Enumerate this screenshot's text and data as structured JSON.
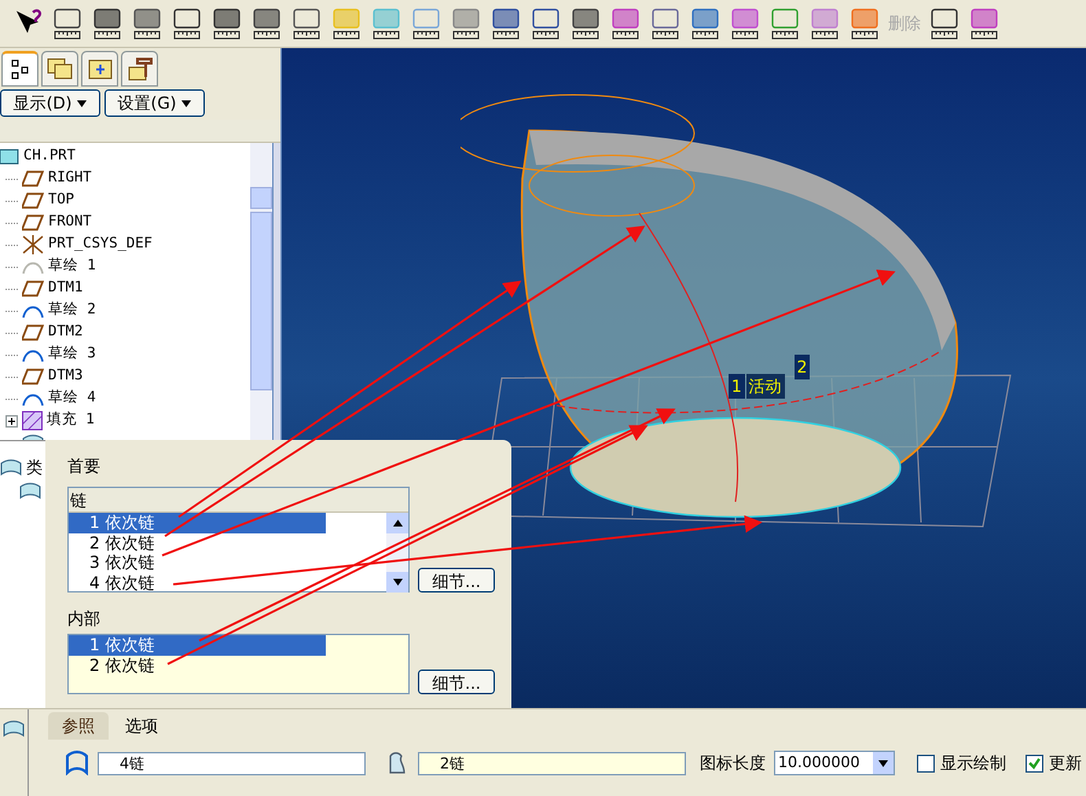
{
  "toolbar": {
    "delete_label": "删除",
    "delete_disabled": true
  },
  "model_tree": {
    "tabs": [
      {
        "kind": "tree",
        "selected": true
      },
      {
        "kind": "layers",
        "selected": false
      },
      {
        "kind": "folder",
        "selected": false
      },
      {
        "kind": "tools",
        "selected": false
      }
    ],
    "buttons": [
      {
        "label": "显示(D)"
      },
      {
        "label": "设置(G)"
      }
    ],
    "items": [
      {
        "kind": "part",
        "label": "CH.PRT"
      },
      {
        "kind": "plane",
        "label": "RIGHT"
      },
      {
        "kind": "plane",
        "label": "TOP"
      },
      {
        "kind": "plane",
        "label": "FRONT"
      },
      {
        "kind": "csys",
        "label": "PRT_CSYS_DEF"
      },
      {
        "kind": "sketch_hidden",
        "label": "草绘 1"
      },
      {
        "kind": "plane",
        "label": "DTM1"
      },
      {
        "kind": "sketch",
        "label": "草绘 2"
      },
      {
        "kind": "plane",
        "label": "DTM2"
      },
      {
        "kind": "sketch",
        "label": "草绘 3"
      },
      {
        "kind": "plane",
        "label": "DTM3"
      },
      {
        "kind": "sketch",
        "label": "草绘 4"
      },
      {
        "kind": "fill",
        "label": "填充 1",
        "expandable": true
      },
      {
        "kind": "surface"
      }
    ]
  },
  "lower_tree": {
    "items": [
      {
        "kind": "surface",
        "label": "类"
      },
      {
        "kind": "surface"
      }
    ]
  },
  "chain_panel": {
    "primary_title": "首要",
    "primary_header": "链",
    "primary_rows": [
      {
        "label": "1 依次链",
        "selected": true
      },
      {
        "label": "2 依次链",
        "selected": false
      },
      {
        "label": "3 依次链",
        "selected": false
      },
      {
        "label": "4 依次链",
        "selected": false
      }
    ],
    "details_button": "细节...",
    "internal_title": "内部",
    "internal_rows": [
      {
        "label": "1 依次链",
        "selected": true
      },
      {
        "label": "2 依次链",
        "selected": false
      }
    ],
    "internal_details_button": "细节..."
  },
  "viewport": {
    "labels": [
      {
        "kind": "tag",
        "text": "1"
      },
      {
        "kind": "plain",
        "text": "活动"
      },
      {
        "kind": "tag",
        "text": "2"
      }
    ]
  },
  "dashboard": {
    "tabs": [
      {
        "label": "参照",
        "selected": true
      },
      {
        "label": "选项",
        "selected": false
      }
    ],
    "first_field": "4链",
    "second_field": "2链",
    "length_label": "图标长度",
    "length_value": "10.000000",
    "show_drawing": {
      "label": "显示绘制",
      "checked": false
    },
    "update": {
      "label": "更新",
      "checked": true
    }
  }
}
